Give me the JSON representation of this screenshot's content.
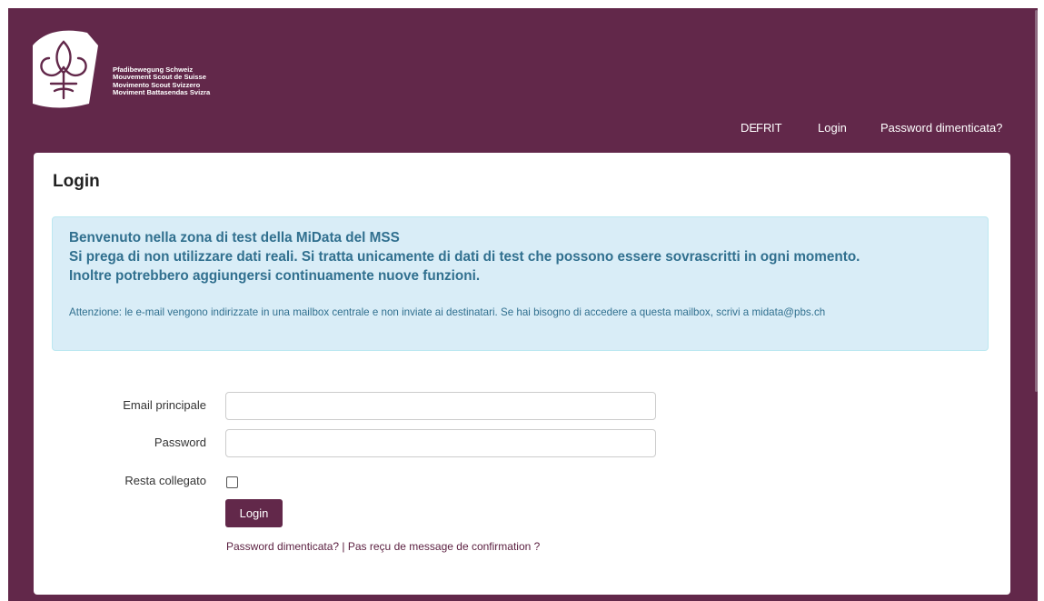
{
  "brand": {
    "lines": [
      "Pfadibewegung Schweiz",
      "Mouvement Scout de Suisse",
      "Movimento Scout Svizzero",
      "Moviment Battasendas Svizra"
    ]
  },
  "nav": {
    "languages": [
      "DE",
      "FR",
      "IT"
    ],
    "login": "Login",
    "forgot": "Password dimenticata?"
  },
  "card": {
    "title": "Login"
  },
  "alert": {
    "line1": "Benvenuto nella zona di test della MiData del MSS",
    "line2": "Si prega di non utilizzare dati reali. Si tratta unicamente di dati di test che possono essere sovrascritti in ogni momento.",
    "line3": "Inoltre potrebbero aggiungersi continuamente nuove funzioni.",
    "note": "Attenzione: le e-mail vengono indirizzate in una mailbox centrale e non inviate ai destinatari. Se hai bisogno di accedere a questa mailbox, scrivi a",
    "email": "midata@pbs.ch"
  },
  "form": {
    "email_label": "Email principale",
    "email_value": "",
    "password_label": "Password",
    "password_value": "",
    "remember_label": "Resta collegato",
    "remember_checked": false,
    "submit": "Login",
    "forgot_link": "Password dimenticata?",
    "separator": "|",
    "confirm_link": "Pas reçu de message de confirmation ?"
  },
  "colors": {
    "brand": "#62284a",
    "alert_bg": "#d9edf7",
    "alert_text": "#31708f"
  }
}
